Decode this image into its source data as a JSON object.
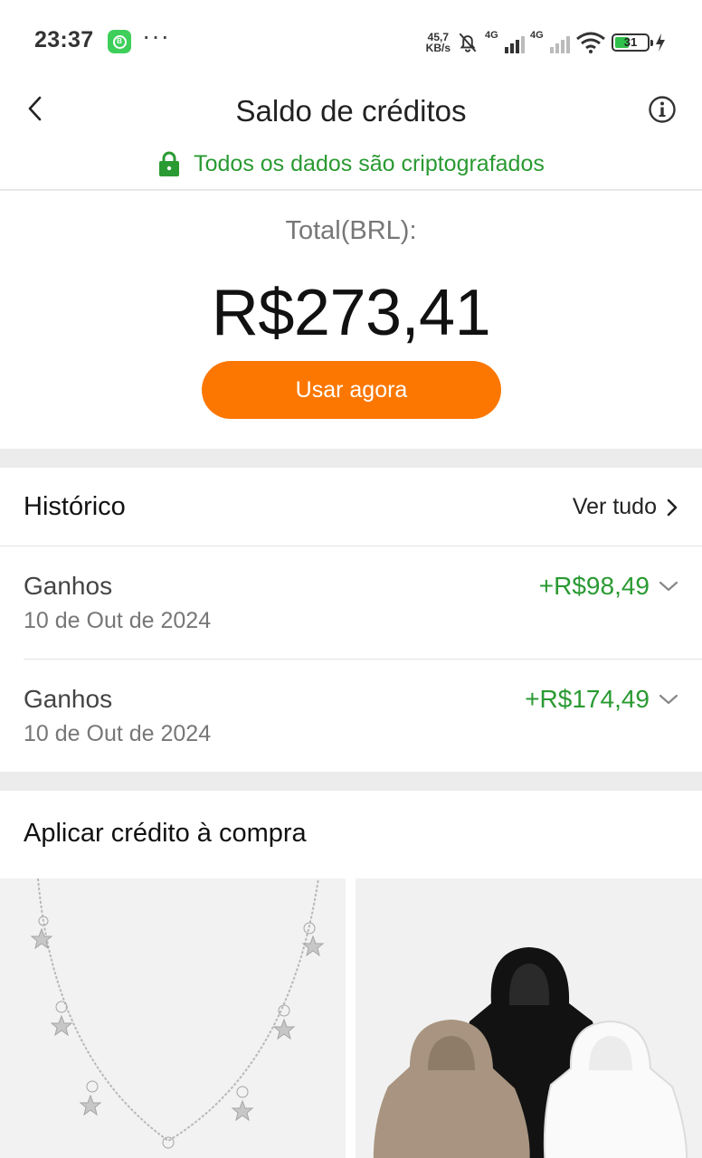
{
  "status_bar": {
    "time": "23:37",
    "app_icon": "whatsapp-business-icon",
    "more": "···",
    "speed_value": "45,7",
    "speed_unit": "KB/s",
    "network1": "4G",
    "network2": "4G",
    "battery_level": "31"
  },
  "header": {
    "title": "Saldo de créditos",
    "secure_text": "Todos os dados são criptografados"
  },
  "balance": {
    "total_label": "Total(BRL):",
    "total_value": "R$273,41",
    "use_button": "Usar agora"
  },
  "history": {
    "title": "Histórico",
    "see_all": "Ver tudo",
    "items": [
      {
        "type": "Ganhos",
        "date": "10 de Out de 2024",
        "amount": "+R$98,49"
      },
      {
        "type": "Ganhos",
        "date": "10 de Out de 2024",
        "amount": "+R$174,49"
      }
    ]
  },
  "apply": {
    "title": "Aplicar crédito à compra"
  },
  "colors": {
    "accent_orange": "#fb7701",
    "positive_green": "#2a9a32"
  }
}
